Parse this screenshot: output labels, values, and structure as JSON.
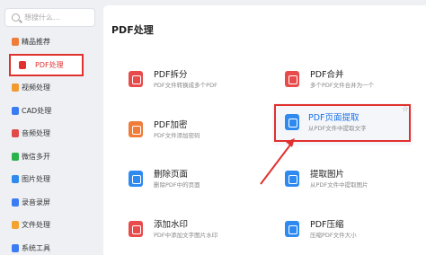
{
  "search": {
    "placeholder": "想搜什么…"
  },
  "sidebar": {
    "items": [
      {
        "label": "精品推荐",
        "icon": "gem-icon",
        "color": "#f07c3a"
      },
      {
        "label": "PDF处理",
        "icon": "pdf-icon",
        "color": "#e0312f",
        "active": true
      },
      {
        "label": "视频处理",
        "icon": "video-icon",
        "color": "#f29a2e"
      },
      {
        "label": "CAD处理",
        "icon": "cad-icon",
        "color": "#3b7cf5"
      },
      {
        "label": "音频处理",
        "icon": "audio-icon",
        "color": "#e24a4a"
      },
      {
        "label": "微信多开",
        "icon": "wechat-icon",
        "color": "#2ab34a"
      },
      {
        "label": "图片处理",
        "icon": "image-icon",
        "color": "#2f8af0"
      },
      {
        "label": "录音录屏",
        "icon": "mic-icon",
        "color": "#3b7cf5"
      },
      {
        "label": "文件处理",
        "icon": "file-icon",
        "color": "#f2a42e"
      },
      {
        "label": "系统工具",
        "icon": "system-icon",
        "color": "#3b7cf5"
      }
    ]
  },
  "main": {
    "title": "PDF处理",
    "tools": [
      {
        "name": "PDF拆分",
        "desc": "PDF文件转换成多个PDF",
        "icon": "split-icon",
        "color": "#e84b4b"
      },
      {
        "name": "PDF合并",
        "desc": "多个PDF文件合并为一个",
        "icon": "merge-icon",
        "color": "#e84b4b"
      },
      {
        "name": "PDF加密",
        "desc": "PDF文件添加密码",
        "icon": "lock-icon",
        "color": "#f07c3a"
      },
      {
        "name": "PDF页面提取",
        "desc": "从PDF文件中提取文字",
        "icon": "extract-page-icon",
        "color": "#2f8af0",
        "highlighted": true
      },
      {
        "name": "删除页面",
        "desc": "删除PDF中的页面",
        "icon": "delete-page-icon",
        "color": "#2f8af0"
      },
      {
        "name": "提取图片",
        "desc": "从PDF文件中提取图片",
        "icon": "extract-image-icon",
        "color": "#2f8af0"
      },
      {
        "name": "添加水印",
        "desc": "PDF中添加文字图片水印",
        "icon": "watermark-icon",
        "color": "#e84b4b"
      },
      {
        "name": "PDF压缩",
        "desc": "压缩PDF文件大小",
        "icon": "compress-icon",
        "color": "#2f8af0"
      }
    ]
  },
  "accent": "#e0312f"
}
